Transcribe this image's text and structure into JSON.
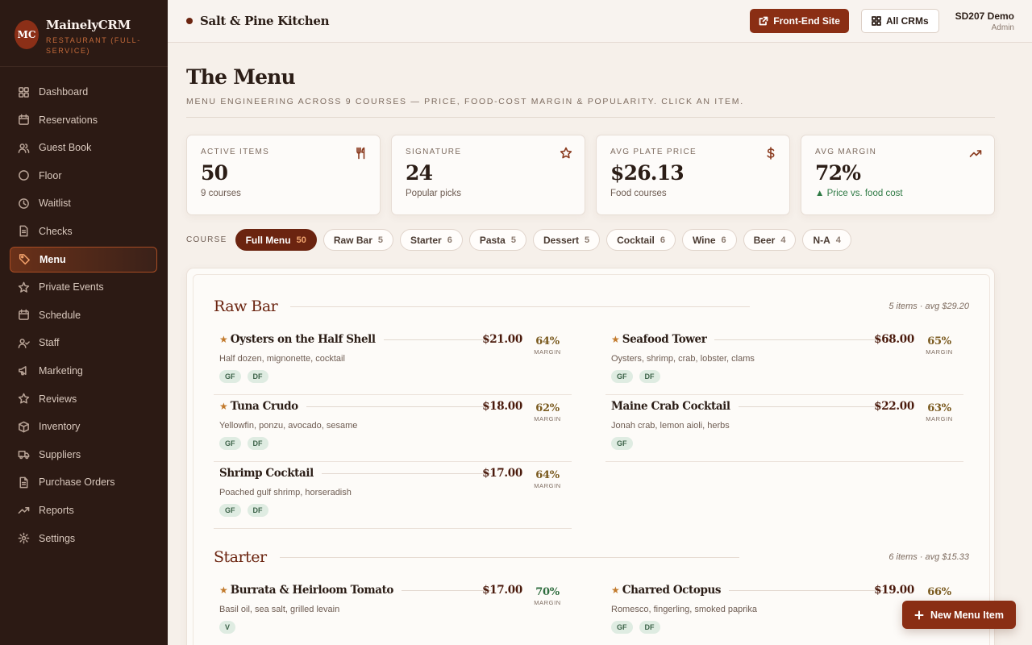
{
  "brand": {
    "logo": "MC",
    "name": "MainelyCRM",
    "subtitle": "Restaurant (Full-Service)"
  },
  "sidebar": {
    "items": [
      {
        "label": "Dashboard",
        "icon": "grid-icon"
      },
      {
        "label": "Reservations",
        "icon": "calendar-icon"
      },
      {
        "label": "Guest Book",
        "icon": "users-icon"
      },
      {
        "label": "Floor",
        "icon": "circle-icon"
      },
      {
        "label": "Waitlist",
        "icon": "clock-icon"
      },
      {
        "label": "Checks",
        "icon": "receipt-icon"
      },
      {
        "label": "Menu",
        "icon": "tag-icon",
        "active": true
      },
      {
        "label": "Private Events",
        "icon": "sparkle-icon"
      },
      {
        "label": "Schedule",
        "icon": "calendar-icon"
      },
      {
        "label": "Staff",
        "icon": "user-check-icon"
      },
      {
        "label": "Marketing",
        "icon": "megaphone-icon"
      },
      {
        "label": "Reviews",
        "icon": "star-icon"
      },
      {
        "label": "Inventory",
        "icon": "box-icon"
      },
      {
        "label": "Suppliers",
        "icon": "truck-icon"
      },
      {
        "label": "Purchase Orders",
        "icon": "document-icon"
      },
      {
        "label": "Reports",
        "icon": "trend-icon"
      },
      {
        "label": "Settings",
        "icon": "gear-icon"
      }
    ]
  },
  "topbar": {
    "location": "Salt & Pine Kitchen",
    "front_end_label": "Front-End Site",
    "all_crms_label": "All CRMs",
    "user_name": "SD207 Demo",
    "user_role": "Admin"
  },
  "page": {
    "title": "The Menu",
    "subtitle": "Menu engineering across 9 courses — price, food-cost margin & popularity. Click an item."
  },
  "stats": [
    {
      "label": "Active Items",
      "value": "50",
      "note": "9 courses",
      "icon": "utensils-icon"
    },
    {
      "label": "Signature",
      "value": "24",
      "note": "Popular picks",
      "icon": "star-icon"
    },
    {
      "label": "Avg Plate Price",
      "value": "$26.13",
      "note": "Food courses",
      "icon": "dollar-icon"
    },
    {
      "label": "Avg Margin",
      "value": "72%",
      "note": "▲ Price vs. food cost",
      "icon": "trend-up-icon"
    }
  ],
  "filters": {
    "label": "Course",
    "chips": [
      {
        "label": "Full Menu",
        "count": "50",
        "active": true
      },
      {
        "label": "Raw Bar",
        "count": "5"
      },
      {
        "label": "Starter",
        "count": "6"
      },
      {
        "label": "Pasta",
        "count": "5"
      },
      {
        "label": "Dessert",
        "count": "5"
      },
      {
        "label": "Cocktail",
        "count": "6"
      },
      {
        "label": "Wine",
        "count": "6"
      },
      {
        "label": "Beer",
        "count": "4"
      },
      {
        "label": "N-A",
        "count": "4"
      }
    ]
  },
  "courses": [
    {
      "title": "Raw Bar",
      "meta": "5 items · avg $29.20",
      "items": [
        {
          "name": "Oysters on the Half Shell",
          "signature": true,
          "price": "$21.00",
          "margin": "64%",
          "margin_label": "Margin",
          "desc": "Half dozen, mignonette, cocktail",
          "tags": [
            "GF",
            "DF"
          ]
        },
        {
          "name": "Seafood Tower",
          "signature": true,
          "price": "$68.00",
          "margin": "65%",
          "margin_label": "Margin",
          "desc": "Oysters, shrimp, crab, lobster, clams",
          "tags": [
            "GF",
            "DF"
          ]
        },
        {
          "name": "Tuna Crudo",
          "signature": true,
          "price": "$18.00",
          "margin": "62%",
          "margin_label": "Margin",
          "desc": "Yellowfin, ponzu, avocado, sesame",
          "tags": [
            "GF",
            "DF"
          ]
        },
        {
          "name": "Maine Crab Cocktail",
          "signature": false,
          "price": "$22.00",
          "margin": "63%",
          "margin_label": "Margin",
          "desc": "Jonah crab, lemon aioli, herbs",
          "tags": [
            "GF"
          ]
        },
        {
          "name": "Shrimp Cocktail",
          "signature": false,
          "price": "$17.00",
          "margin": "64%",
          "margin_label": "Margin",
          "desc": "Poached gulf shrimp, horseradish",
          "tags": [
            "GF",
            "DF"
          ]
        }
      ]
    },
    {
      "title": "Starter",
      "meta": "6 items · avg $15.33",
      "items": [
        {
          "name": "Burrata & Heirloom Tomato",
          "signature": true,
          "price": "$17.00",
          "margin": "70%",
          "margin_label": "Margin",
          "desc": "Basil oil, sea salt, grilled levain",
          "tags": [
            "V"
          ]
        },
        {
          "name": "Charred Octopus",
          "signature": true,
          "price": "$19.00",
          "margin": "66%",
          "margin_label": "",
          "desc": "Romesco, fingerling, smoked paprika",
          "tags": [
            "GF",
            "DF"
          ]
        }
      ]
    }
  ],
  "fab": {
    "label": "New Menu Item"
  },
  "colors": {
    "accent": "#8a2e14",
    "sidebar": "#2c1a14",
    "course_title": "#6b2410",
    "signature_star": "#c27a2c",
    "positive": "#2f7a45"
  }
}
